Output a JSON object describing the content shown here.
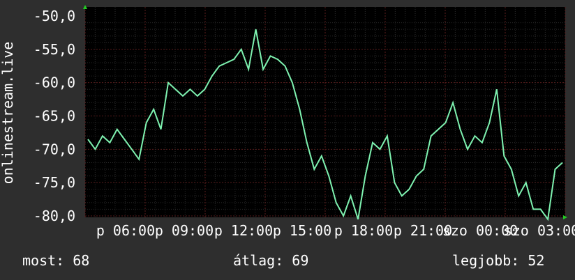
{
  "chart_data": {
    "type": "line",
    "ylabel": "onlinestream.live",
    "y_ticks": [
      "-50,0",
      "-55,0",
      "-60,0",
      "-65,0",
      "-70,0",
      "-75,0",
      "-80,0"
    ],
    "x_ticks": [
      "p 06:00",
      "p 09:00",
      "p 12:00",
      "p 15:00",
      "p 18:00",
      "p 21:00",
      "szo 00:00",
      "szo 03:00"
    ],
    "ylim": [
      -80.5,
      -49.5
    ],
    "x_range": [
      0,
      130
    ],
    "grid": true,
    "series": [
      {
        "color": "#7ef2b0",
        "values": [
          [
            0,
            -68.5
          ],
          [
            2,
            -70
          ],
          [
            4,
            -68
          ],
          [
            6,
            -69
          ],
          [
            8,
            -67
          ],
          [
            10,
            -68.5
          ],
          [
            12,
            -70
          ],
          [
            14,
            -71.5
          ],
          [
            16,
            -66
          ],
          [
            18,
            -64
          ],
          [
            20,
            -67
          ],
          [
            22,
            -60
          ],
          [
            24,
            -61
          ],
          [
            26,
            -62
          ],
          [
            28,
            -61
          ],
          [
            30,
            -62
          ],
          [
            32,
            -61
          ],
          [
            34,
            -59
          ],
          [
            36,
            -57.5
          ],
          [
            38,
            -57
          ],
          [
            40,
            -56.5
          ],
          [
            42,
            -55
          ],
          [
            44,
            -58
          ],
          [
            46,
            -52
          ],
          [
            48,
            -58
          ],
          [
            50,
            -56
          ],
          [
            52,
            -56.5
          ],
          [
            54,
            -57.5
          ],
          [
            56,
            -60
          ],
          [
            58,
            -64
          ],
          [
            60,
            -69
          ],
          [
            62,
            -73
          ],
          [
            64,
            -71
          ],
          [
            66,
            -74
          ],
          [
            68,
            -78
          ],
          [
            70,
            -80
          ],
          [
            72,
            -77
          ],
          [
            74,
            -80.5
          ],
          [
            76,
            -74
          ],
          [
            78,
            -69
          ],
          [
            80,
            -70
          ],
          [
            82,
            -68
          ],
          [
            84,
            -75
          ],
          [
            86,
            -77
          ],
          [
            88,
            -76
          ],
          [
            90,
            -74
          ],
          [
            92,
            -73
          ],
          [
            94,
            -68
          ],
          [
            96,
            -67
          ],
          [
            98,
            -66
          ],
          [
            100,
            -63
          ],
          [
            102,
            -67
          ],
          [
            104,
            -70
          ],
          [
            106,
            -68
          ],
          [
            108,
            -69
          ],
          [
            110,
            -66
          ],
          [
            112,
            -61
          ],
          [
            114,
            -71
          ],
          [
            116,
            -73
          ],
          [
            118,
            -77
          ],
          [
            120,
            -75
          ],
          [
            122,
            -79
          ],
          [
            124,
            -79
          ],
          [
            126,
            -80.5
          ],
          [
            128,
            -73
          ],
          [
            130,
            -72
          ]
        ]
      }
    ],
    "stats": {
      "current": "most: 68",
      "average": "átlag: 69",
      "best": "legjobb: 52"
    }
  }
}
